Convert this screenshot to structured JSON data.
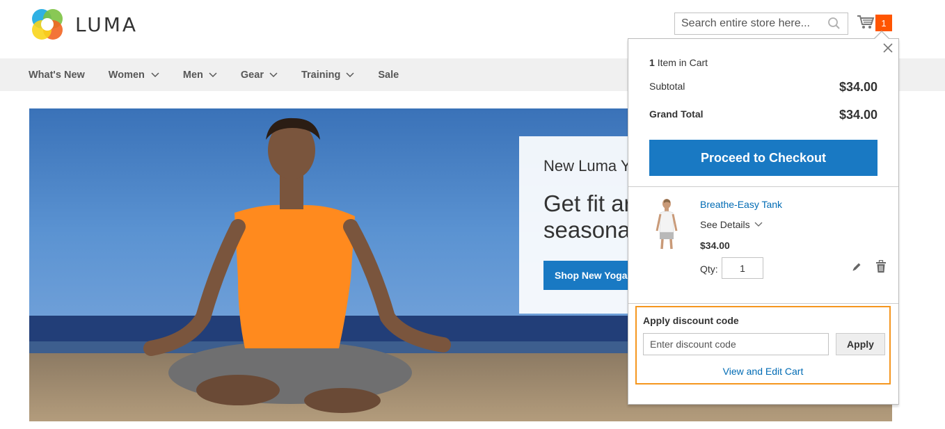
{
  "header": {
    "logo_text": "LUMA",
    "search_placeholder": "Search entire store here...",
    "cart_count": "1"
  },
  "nav": {
    "items": [
      "What's New",
      "Women",
      "Men",
      "Gear",
      "Training",
      "Sale"
    ]
  },
  "hero": {
    "promo_subtitle": "New Luma Y",
    "promo_title_line1": "Get fit ar",
    "promo_title_line2": "seasona",
    "promo_button": "Shop New Yoga"
  },
  "minicart": {
    "items_count_number": "1",
    "items_count_text": "Item in Cart",
    "subtotal_label": "Subtotal",
    "subtotal_value": "$34.00",
    "grand_total_label": "Grand Total",
    "grand_total_value": "$34.00",
    "checkout_button": "Proceed to Checkout",
    "product": {
      "name": "Breathe-Easy Tank",
      "see_details": "See Details",
      "price": "$34.00",
      "qty_label": "Qty:",
      "qty_value": "1"
    },
    "discount": {
      "title": "Apply discount code",
      "placeholder": "Enter discount code",
      "apply_button": "Apply"
    },
    "view_edit_link": "View and Edit Cart"
  },
  "colors": {
    "brand_blue": "#1979c3",
    "link_blue": "#006bb4",
    "cart_badge": "#ff5501",
    "highlight_border": "#f5961e"
  }
}
